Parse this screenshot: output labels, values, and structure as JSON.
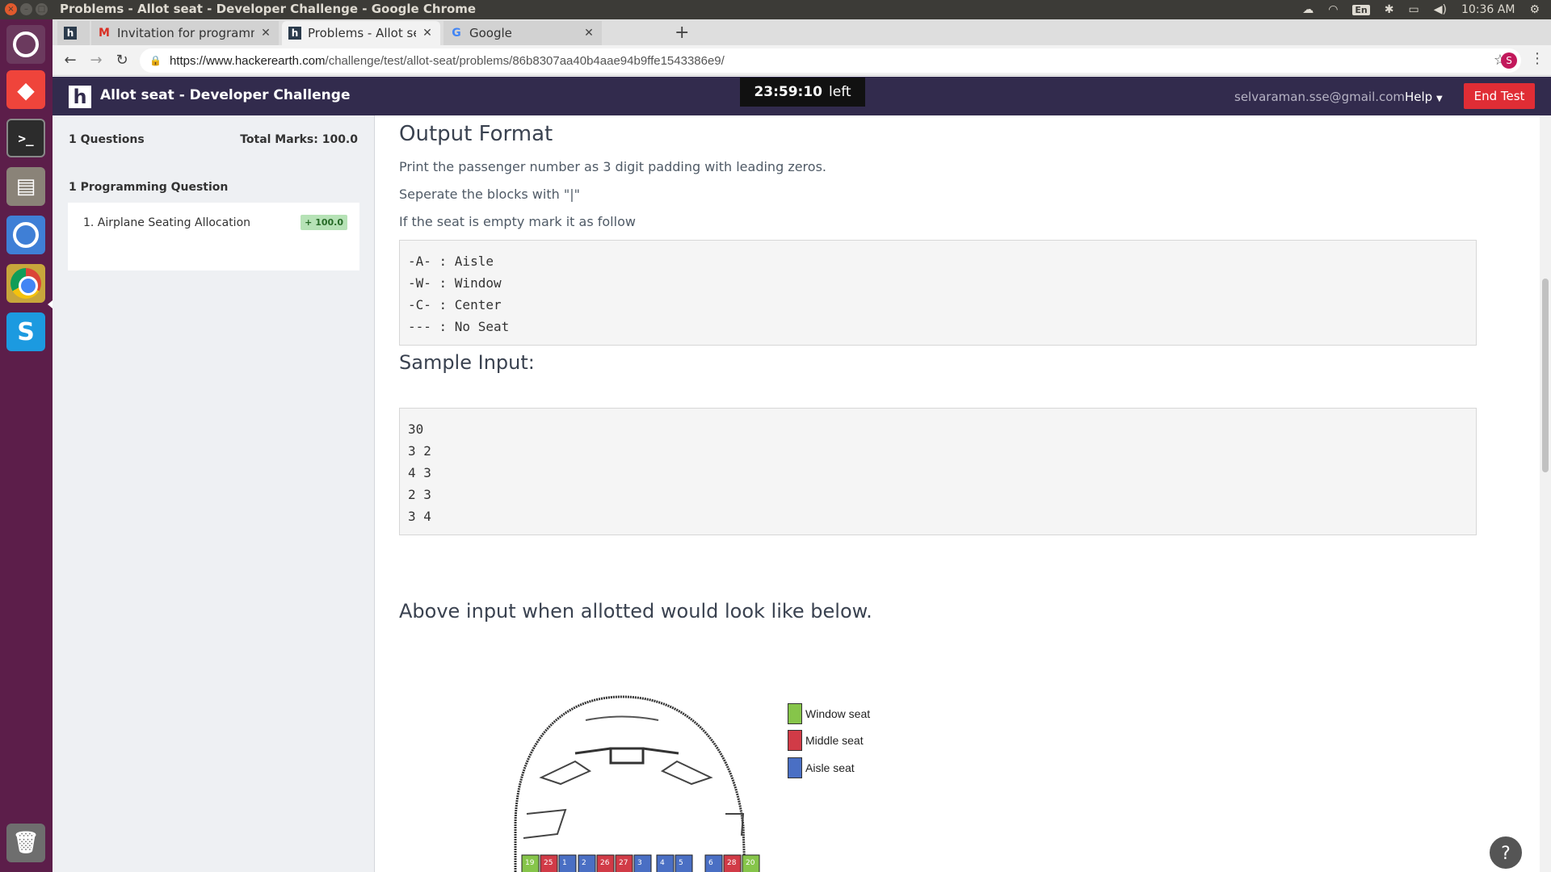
{
  "os": {
    "window_title": "Problems - Allot seat - Developer Challenge - Google Chrome",
    "keyboard_layout": "En",
    "clock": "10:36 AM"
  },
  "browser": {
    "tabs": [
      {
        "label": "",
        "favicon": "hackerearth-icon"
      },
      {
        "label": "Invitation for programmi",
        "favicon": "gmail-icon"
      },
      {
        "label": "Problems - Allot seat - De",
        "favicon": "hackerearth-icon"
      },
      {
        "label": "Google",
        "favicon": "google-icon"
      }
    ],
    "url_host": "https://www.hackerearth.com",
    "url_path": "/challenge/test/allot-seat/problems/86b8307aa40b4aae94b9ffe1543386e9/",
    "profile_initial": "S"
  },
  "header": {
    "logo": "h",
    "title": "Allot seat - Developer Challenge",
    "timer": "23:59:10",
    "timer_suffix": "left",
    "email": "selvaraman.sse@gmail.com",
    "help": "Help",
    "end_test": "End Test"
  },
  "sidebar": {
    "questions_count": "1 Questions",
    "total_marks": "Total Marks: 100.0",
    "section_title": "1 Programming Question",
    "items": [
      {
        "label": "1. Airplane Seating Allocation",
        "badge": "+ 100.0"
      }
    ]
  },
  "content": {
    "output_format_heading": "Output Format",
    "para1": "Print the passenger number as 3 digit padding with leading zeros.",
    "para2": "Seperate the blocks with \"|\"",
    "para3": "If the seat is empty mark it as follow",
    "legend_code": [
      "-A- : Aisle",
      "-W- : Window",
      "-C- : Center",
      "--- : No Seat"
    ],
    "sample_input_heading": "Sample Input:",
    "sample_input": [
      "30",
      "3 2",
      "4 3",
      "2 3",
      "3 4"
    ],
    "above_heading": "Above input when allotted would look like below.",
    "diagram_legend": [
      {
        "label": "Window seat",
        "color": "#86c54a"
      },
      {
        "label": "Middle seat",
        "color": "#d13b47"
      },
      {
        "label": "Aisle seat",
        "color": "#4a6fc4"
      }
    ],
    "seat_rows": [
      [
        {
          "n": "19",
          "t": "W"
        },
        {
          "n": "25",
          "t": "M"
        },
        {
          "n": "1",
          "t": "A"
        }
      ],
      [
        {
          "n": "2",
          "t": "A"
        },
        {
          "n": "26",
          "t": "M"
        },
        {
          "n": "27",
          "t": "M"
        },
        {
          "n": "3",
          "t": "A"
        }
      ],
      [
        {
          "n": "4",
          "t": "A"
        },
        {
          "n": "5",
          "t": "A"
        }
      ],
      [
        {
          "n": "6",
          "t": "A"
        },
        {
          "n": "28",
          "t": "M"
        },
        {
          "n": "20",
          "t": "W"
        }
      ]
    ]
  },
  "colors": {
    "header_bg": "#322b4d",
    "end_button": "#e02d35",
    "launcher": "#5c1e4a"
  }
}
